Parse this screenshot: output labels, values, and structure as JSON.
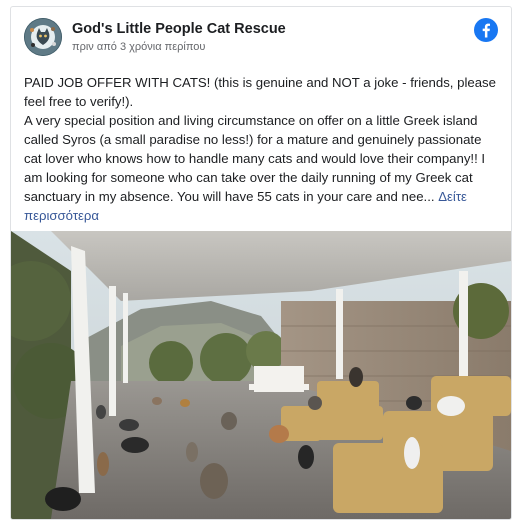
{
  "post": {
    "page_name": "God's Little People Cat Rescue",
    "timestamp": "πριν από 3 χρόνια περίπου",
    "paragraph_1": "PAID JOB OFFER WITH CATS! (this is genuine and NOT a joke - friends, please feel free to verify!).",
    "paragraph_2": "A very special position and living circumstance on offer on a little Greek island called Syros (a small paradise no less!) for a mature and genuinely passionate cat lover who knows how to handle many cats and would love their company!! I am looking for someone who can take over the daily running of my Greek cat sanctuary in my absence. You will have 55 cats in your care and nee...",
    "see_more": "Δείτε περισσότερα"
  },
  "icons": {
    "platform": "facebook-icon"
  },
  "colors": {
    "link": "#385898",
    "facebook_blue": "#1877f2",
    "text": "#1c1e21",
    "meta": "#65676b"
  }
}
